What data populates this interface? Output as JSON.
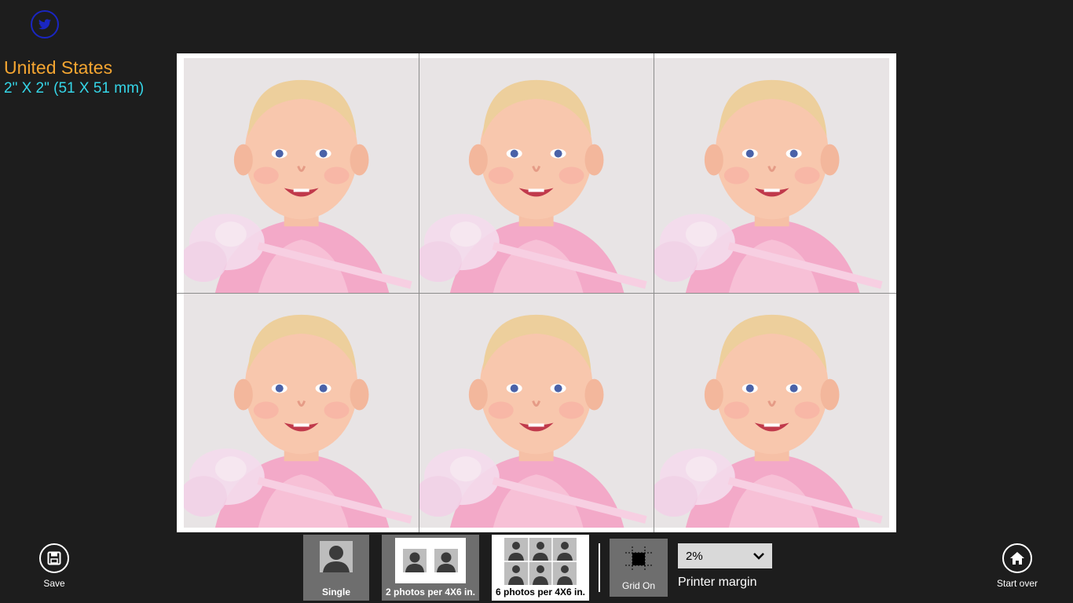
{
  "header": {
    "country": "United States",
    "size_spec": "2\" X 2\" (51 X 51 mm)"
  },
  "colors": {
    "country": "#f4a531",
    "size_spec": "#35d6e8",
    "twitter_ring": "#1a26c2",
    "background": "#1d1d1d"
  },
  "sheet": {
    "rows": 2,
    "columns": 3,
    "photo_count": 6
  },
  "appbar": {
    "save_label": "Save",
    "start_over_label": "Start over",
    "layouts": [
      {
        "label": "Single",
        "selected": false
      },
      {
        "label": "2 photos per 4X6 in.",
        "selected": false
      },
      {
        "label": "6 photos per 4X6 in.",
        "selected": true
      }
    ],
    "grid_label": "Grid On",
    "margin_value": "2%",
    "margin_label": "Printer margin"
  },
  "icons": {
    "twitter": "twitter-icon",
    "save": "save-icon",
    "home": "home-icon",
    "grid": "grid-icon",
    "dropdown": "chevron-down-icon"
  }
}
